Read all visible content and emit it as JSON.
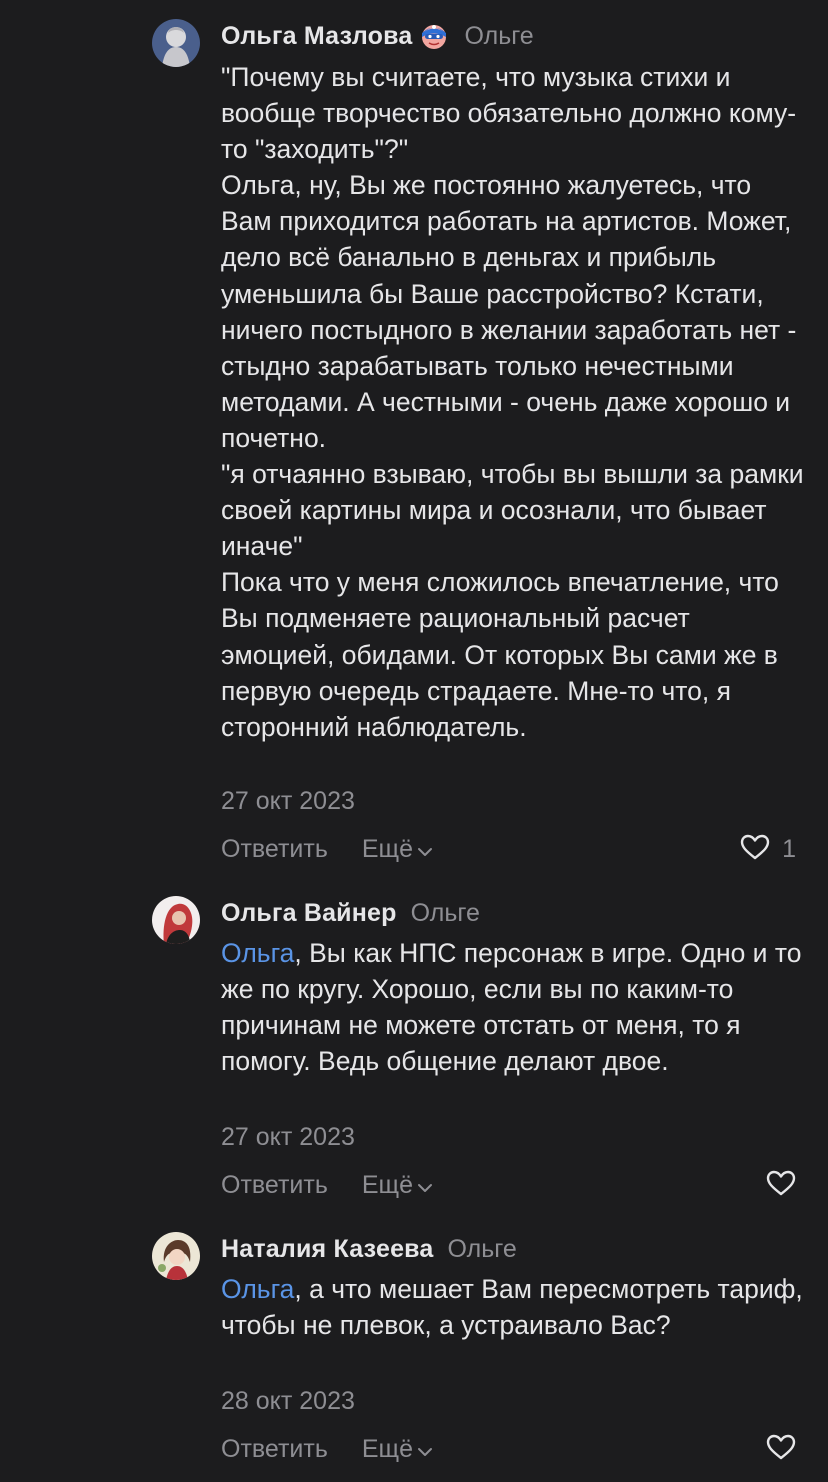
{
  "comments": [
    {
      "author": "Ольга Мазлова",
      "badge_icon": "superhero-emoji-icon",
      "reply_to": "Ольге",
      "mention": "",
      "text": "\"Почему вы считаете, что музыка стихи и вообще творчество обязательно должно кому-то \"заходить\"?\"\nОльга, ну, Вы же постоянно жалуетесь, что Вам приходится работать на артистов. Может, дело всё банально в деньгах и прибыль уменьшила бы Ваше расстройство? Кстати, ничего постыдного в желании заработать нет - стыдно зарабатывать только нечестными методами. А честными - очень даже хорошо и почетно.\n\"я отчаянно взываю, чтобы вы вышли за рамки своей картины мира и осознали, что бывает иначе\"\nПока что у меня сложилось впечатление, что Вы подменяете рациональный расчет эмоцией, обидами. От которых Вы сами же в первую очередь страдаете. Мне-то что, я сторонний наблюдатель.",
      "date": "27 окт 2023",
      "reply_label": "Ответить",
      "more_label": "Ещё",
      "likes": "1"
    },
    {
      "author": "Ольга Вайнер",
      "reply_to": "Ольге",
      "mention": "Ольга",
      "text": ", Вы как НПС персонаж в игре. Одно и то же по кругу. Хорошо, если вы по каким-то причинам не можете отстать от меня, то я помогу. Ведь общение делают двое.",
      "date": "27 окт 2023",
      "reply_label": "Ответить",
      "more_label": "Ещё",
      "likes": ""
    },
    {
      "author": "Наталия Казеева",
      "reply_to": "Ольге",
      "mention": "Ольга",
      "text": ", а что мешает Вам пересмотреть тариф, чтобы не плевок, а устраивало Вас?",
      "date": "28 окт 2023",
      "reply_label": "Ответить",
      "more_label": "Ещё",
      "likes": ""
    }
  ],
  "colors": {
    "background": "#1c1c1e",
    "text": "#e6e6e8",
    "secondary": "#8e8e93",
    "mention": "#5a94e6"
  }
}
